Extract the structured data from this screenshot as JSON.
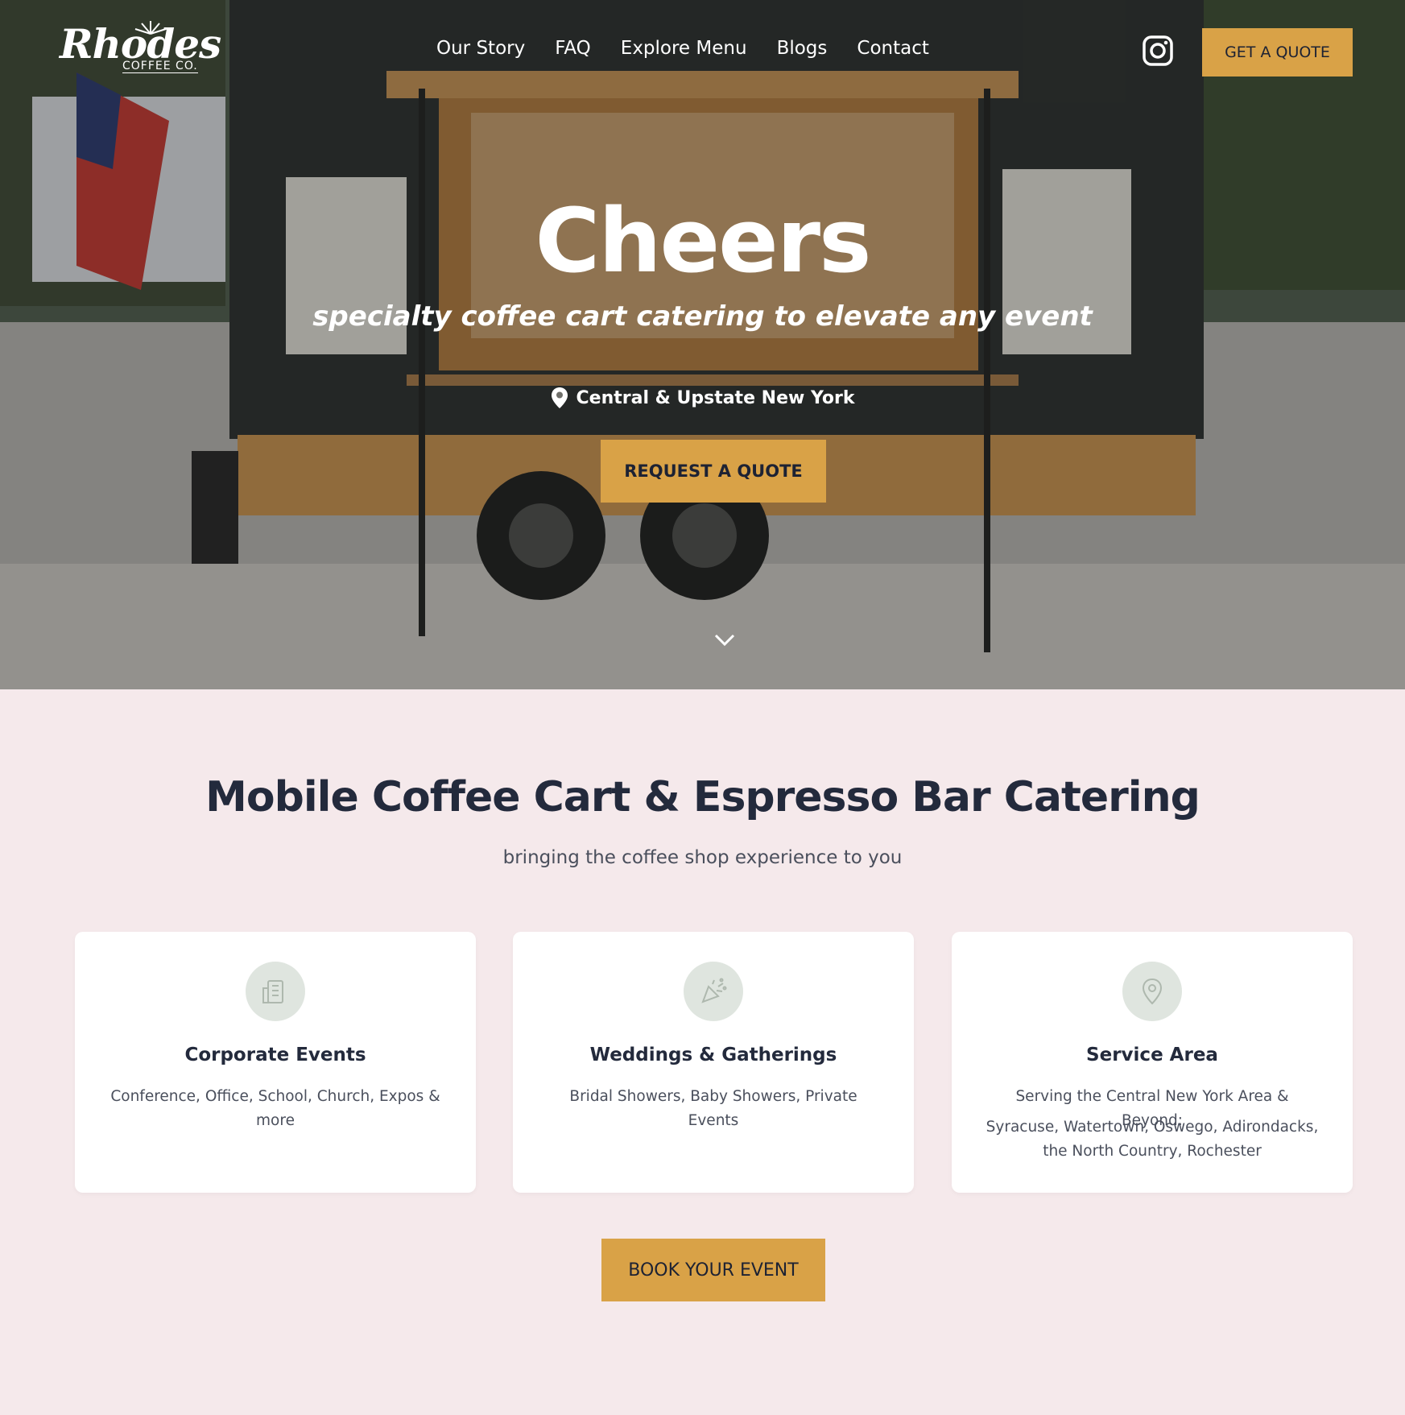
{
  "brand": {
    "logo_script": "Rhodes",
    "logo_sub": "COFFEE CO."
  },
  "nav": {
    "items": [
      {
        "label": "Our Story"
      },
      {
        "label": "FAQ"
      },
      {
        "label": "Explore Menu"
      },
      {
        "label": "Blogs"
      },
      {
        "label": "Contact"
      }
    ],
    "instagram_icon": "instagram-icon",
    "quote_button": "GET A QUOTE"
  },
  "hero": {
    "title": "Cheers",
    "subtitle": "specialty coffee cart catering to elevate any event",
    "location": "Central & Upstate New York",
    "location_icon": "map-pin-icon",
    "cta": "REQUEST A QUOTE",
    "scroll_icon": "chevron-down-icon"
  },
  "section": {
    "title": "Mobile Coffee Cart & Espresso Bar Catering",
    "subtitle": "bringing the coffee shop experience to you",
    "cards": [
      {
        "icon": "building-icon",
        "title": "Corporate Events",
        "text": "Conference, Office, School, Church, Expos & more",
        "text2": ""
      },
      {
        "icon": "party-popper-icon",
        "title": "Weddings & Gatherings",
        "text": "Bridal Showers, Baby Showers, Private Events",
        "text2": ""
      },
      {
        "icon": "location-pin-icon",
        "title": "Service Area",
        "text": "Serving the Central New York Area & Beyond:",
        "text2": "Syracuse, Watertown, Oswego, Adirondacks, the North Country, Rochester"
      }
    ],
    "cta": "BOOK YOUR EVENT"
  },
  "colors": {
    "accent": "#d9a247",
    "page_bg": "#f5e9eb",
    "heading": "#232a3c",
    "icon_circle": "#dfe5df"
  }
}
